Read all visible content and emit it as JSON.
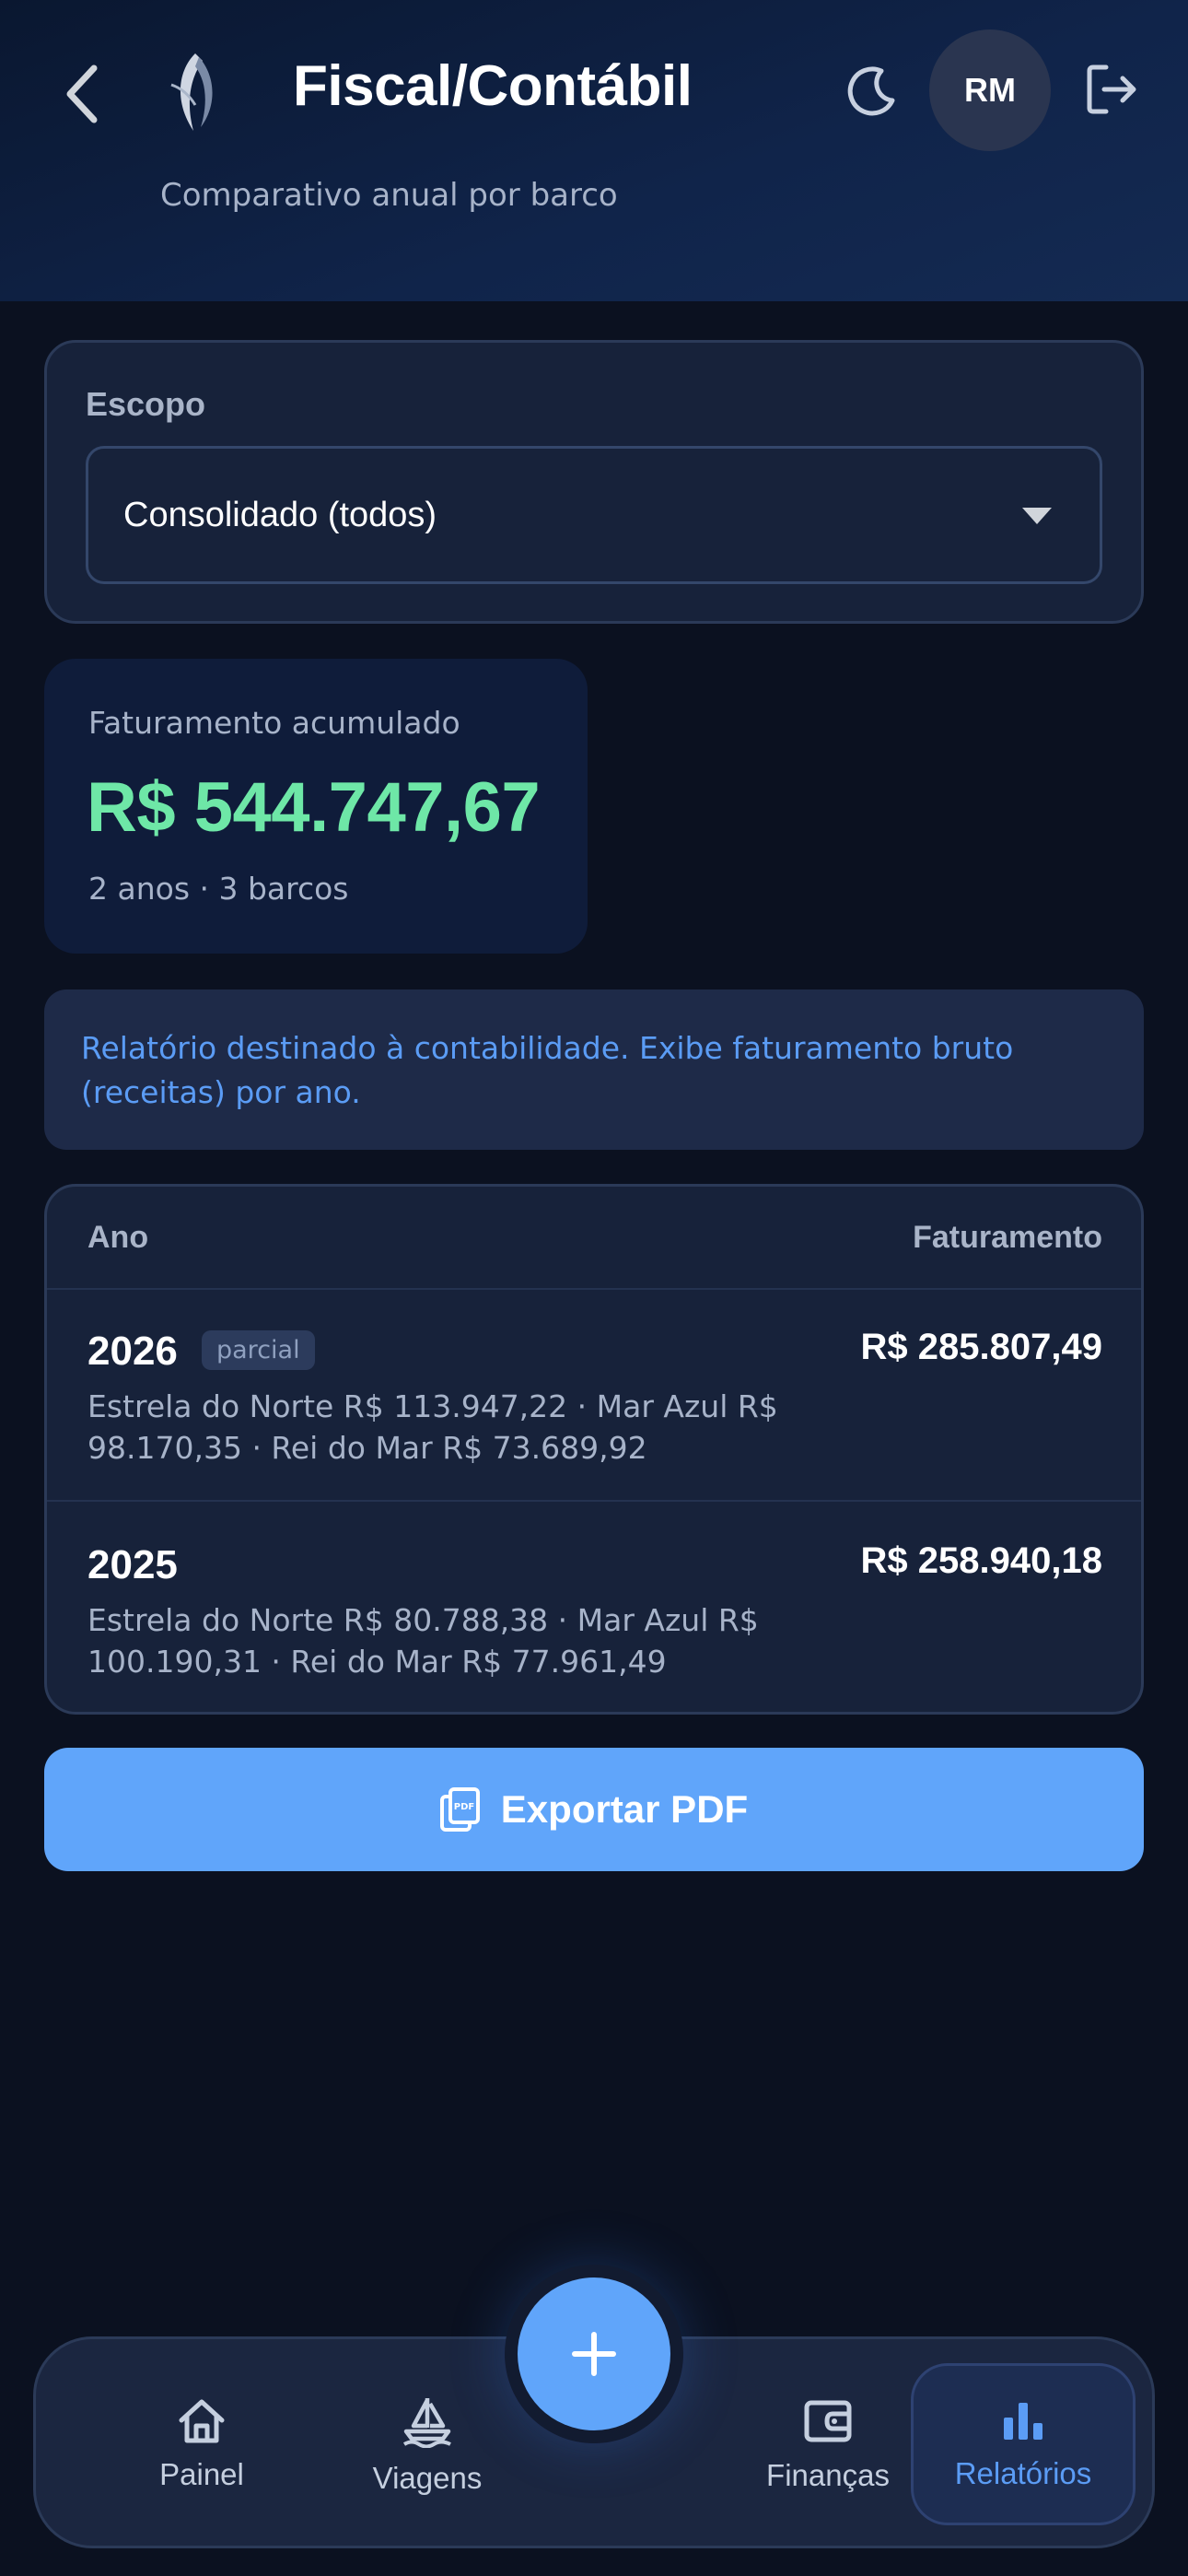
{
  "header": {
    "title": "Fiscal/Contábil",
    "subtitle": "Comparativo anual por barco",
    "avatar_initials": "RM",
    "icons": [
      "chevron-left-icon",
      "marlin-logo",
      "moon-icon",
      "logout-icon"
    ]
  },
  "scope": {
    "label": "Escopo",
    "selected": "Consolidado (todos)"
  },
  "revenue": {
    "label": "Faturamento acumulado",
    "value": "R$ 544.747,67",
    "summary": "2 anos · 3 barcos"
  },
  "info": {
    "text": "Relatório destinado à contabilidade. Exibe faturamento bruto (receitas) por ano."
  },
  "table": {
    "col_year": "Ano",
    "col_revenue": "Faturamento",
    "rows": [
      {
        "year": "2026",
        "badge": "parcial",
        "total": "R$ 285.807,49",
        "detail": "Estrela do Norte R$ 113.947,22 · Mar Azul R$ 98.170,35 · Rei do Mar R$ 73.689,92"
      },
      {
        "year": "2025",
        "total": "R$ 258.940,18",
        "detail": "Estrela do Norte R$ 80.788,38 · Mar Azul R$ 100.190,31 · Rei do Mar R$ 77.961,49"
      }
    ]
  },
  "export": {
    "label": "Exportar PDF"
  },
  "nav": {
    "items": [
      {
        "label": "Painel",
        "icon": "home-icon"
      },
      {
        "label": "Viagens",
        "icon": "sailboat-icon"
      },
      {
        "label": "Finanças",
        "icon": "wallet-icon"
      },
      {
        "label": "Relatórios",
        "icon": "bar-chart-icon",
        "active": true
      }
    ]
  },
  "colors": {
    "accent": "#60a5fa",
    "positive": "#6ee7a7",
    "background": "#0b1120",
    "card": "#17223a"
  }
}
